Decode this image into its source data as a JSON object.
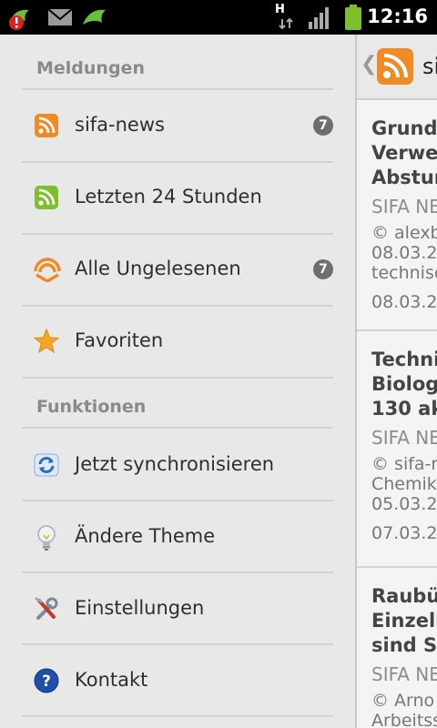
{
  "status_bar": {
    "time": "12:16",
    "network_letter": "H",
    "icons": [
      "app-alert-icon",
      "mail-icon",
      "app-icon",
      "network-h-icon",
      "signal-icon",
      "battery-icon"
    ]
  },
  "drawer": {
    "sections": [
      {
        "header": "Meldungen",
        "items": [
          {
            "label": "sifa-news",
            "icon": "rss-icon",
            "badge": "7"
          },
          {
            "label": "Letzten 24 Stunden",
            "icon": "rss-green-icon"
          },
          {
            "label": "Alle Ungelesenen",
            "icon": "unread-feed-icon",
            "badge": "7"
          },
          {
            "label": "Favoriten",
            "icon": "star-icon"
          }
        ]
      },
      {
        "header": "Funktionen",
        "items": [
          {
            "label": "Jetzt synchronisieren",
            "icon": "sync-icon"
          },
          {
            "label": "Ändere Theme",
            "icon": "lightbulb-icon"
          },
          {
            "label": "Einstellungen",
            "icon": "tools-icon"
          },
          {
            "label": "Kontakt",
            "icon": "help-icon"
          }
        ]
      }
    ]
  },
  "pane": {
    "title": "si",
    "articles": [
      {
        "title_lines": [
          "Grund",
          "Verwe",
          "Abstur"
        ],
        "source": "SIFA NE",
        "lines": [
          "© alexb",
          "08.03.2",
          "technisc"
        ],
        "date": "08.03.20"
      },
      {
        "title_lines": [
          "Techni",
          "Biologi",
          "130 ak"
        ],
        "source": "SIFA NE",
        "lines": [
          "© sifa-n",
          "Chemika",
          "05.03.2"
        ],
        "date": "07.03.20"
      },
      {
        "title_lines": [
          "Raubü",
          "Einzell",
          "sind Si"
        ],
        "source": "SIFA NE",
        "lines": [
          "© Arno",
          "Arbeitss"
        ],
        "date": ""
      }
    ]
  },
  "colors": {
    "rss_orange": "#f08a24",
    "rss_green": "#7cc12c",
    "badge_gray": "#6e6e6e",
    "star_gold": "#f5a623",
    "header_gray": "#8a8a8a"
  }
}
